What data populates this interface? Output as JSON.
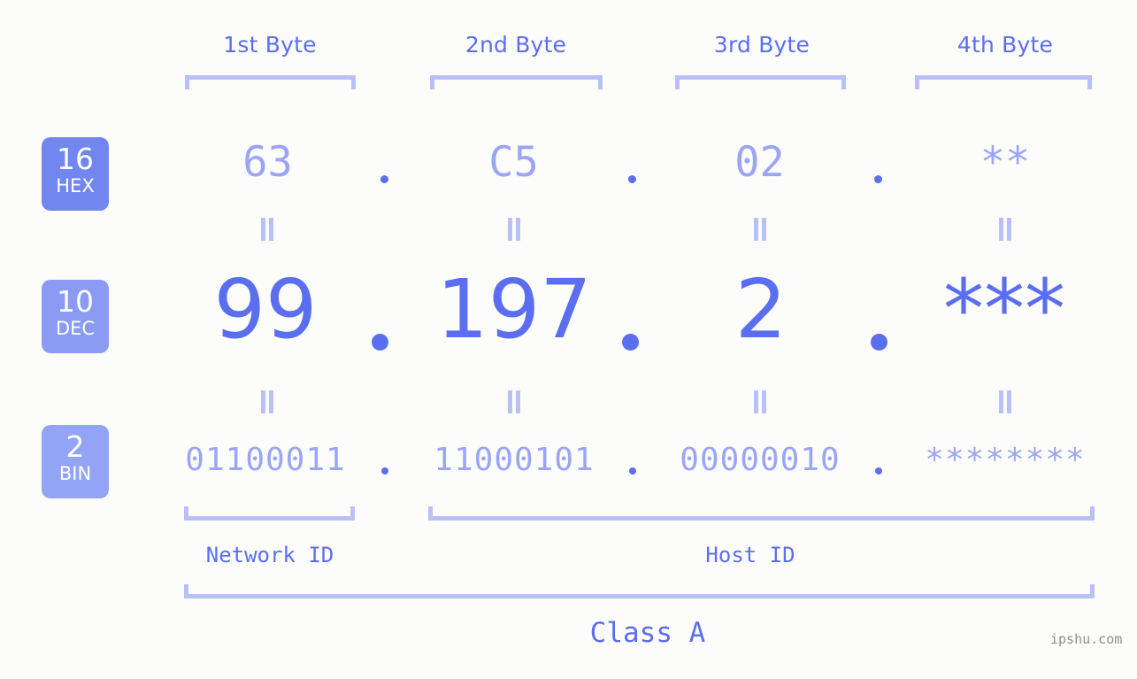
{
  "title": "IP address byte breakdown",
  "colors": {
    "background": "#fcfdfa",
    "accent_strong": "#5b6ef0",
    "accent_light": "#9aa6f5",
    "bracket": "#b9c0f8",
    "badge_hex": "#7186ee",
    "badge_dec": "#8b9bf3",
    "badge_bin": "#93a3f6",
    "watermark": "#8d8d8d"
  },
  "byte_headers": [
    {
      "label": "1st Byte"
    },
    {
      "label": "2nd Byte"
    },
    {
      "label": "3rd Byte"
    },
    {
      "label": "4th Byte"
    }
  ],
  "rows": {
    "hex": {
      "badge_number": "16",
      "badge_abbr": "HEX",
      "values": [
        "63",
        "C5",
        "02",
        "**"
      ],
      "separator": "."
    },
    "dec": {
      "badge_number": "10",
      "badge_abbr": "DEC",
      "values": [
        "99",
        "197",
        "2",
        "***"
      ],
      "separator": "."
    },
    "bin": {
      "badge_number": "2",
      "badge_abbr": "BIN",
      "values": [
        "01100011",
        "11000101",
        "00000010",
        "********"
      ],
      "separator": "."
    }
  },
  "equality_marks": {
    "symbol": "=",
    "count_per_row": 4
  },
  "captions": {
    "network_id": "Network ID",
    "host_id": "Host ID",
    "class": "Class A"
  },
  "watermark": "ipshu.com"
}
